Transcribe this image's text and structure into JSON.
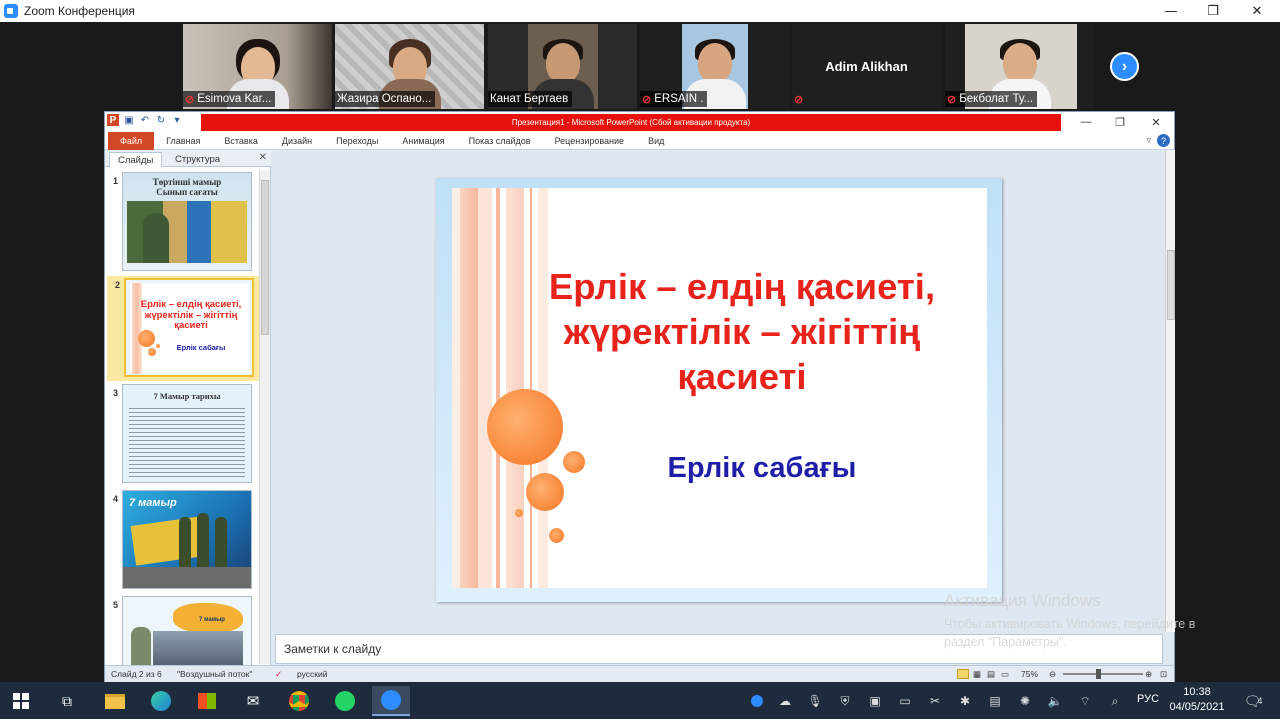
{
  "zoom": {
    "window_title": "Zoom Конференция",
    "participants": [
      {
        "name": "Esimova Kar...",
        "muted": true
      },
      {
        "name": "Жазира Оспано...",
        "muted": false
      },
      {
        "name": "Канат Бертаев",
        "muted": false,
        "active_speaker": true
      },
      {
        "name": "ERSAIN .",
        "muted": true
      },
      {
        "name": "Adim Alikhan",
        "muted": true,
        "video_off": true
      },
      {
        "name": "Бекболат Ту...",
        "muted": true
      }
    ],
    "next_arrow": "›"
  },
  "powerpoint": {
    "title": "Презентация1 - Microsoft PowerPoint (Сбой активации продукта)",
    "ribbon_tabs": [
      "Файл",
      "Главная",
      "Вставка",
      "Дизайн",
      "Переходы",
      "Анимация",
      "Показ слайдов",
      "Рецензирование",
      "Вид"
    ],
    "pane_tabs": [
      "Слайды",
      "Структура"
    ],
    "thumbnails": [
      {
        "num": "1",
        "title_line1": "Төртінші мамыр",
        "title_line2": "Сынып сағаты"
      },
      {
        "num": "2",
        "title": "Ерлік – елдің қасиеті, жүректілік – жігіттің қасиеті",
        "subtitle": "Ерлік сабағы"
      },
      {
        "num": "3",
        "title": "7 Мамыр тарихы"
      },
      {
        "num": "4",
        "title": "7 мамыр"
      },
      {
        "num": "5",
        "title": "7 мамыр"
      }
    ],
    "slide": {
      "title": "Ерлік – елдің қасиеті, жүректілік – жігіттің қасиеті",
      "subtitle": "Ерлік сабағы"
    },
    "notes_placeholder": "Заметки к слайду",
    "status": {
      "slide_info": "Слайд 2 из 6",
      "theme": "\"Воздушный поток\"",
      "language": "русский",
      "zoom": "75%"
    }
  },
  "watermark": {
    "line1": "Активация Windows",
    "line2": "Чтобы активировать Windows, перейдите в",
    "line3": "раздел \"Параметры\"."
  },
  "taskbar": {
    "lang": "РУС",
    "time": "10:38",
    "date": "04/05/2021",
    "notifications": "4"
  }
}
